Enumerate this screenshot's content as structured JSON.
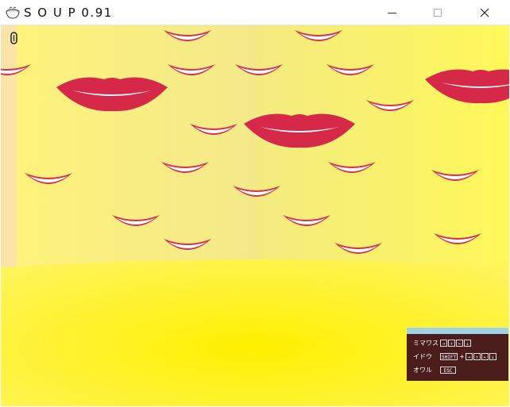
{
  "window": {
    "title": "S O U P 0.91",
    "minimize_icon": "minimize-icon",
    "maximize_icon": "maximize-icon",
    "close_icon": "close-icon"
  },
  "scene": {
    "hud_icon": "paperclip-icon",
    "colors": {
      "wall": "#f4ec6e",
      "floor": "#fff200",
      "lips": "#d8304a",
      "teeth": "#ffffff"
    }
  },
  "help": {
    "rows": [
      {
        "label": "ミマワス",
        "keys": [
          "→",
          "↑",
          "←",
          "↓"
        ],
        "modifier": ""
      },
      {
        "label": "イドウ",
        "keys": [
          "→",
          "↑",
          "←",
          "↓"
        ],
        "modifier": "SHIFT"
      },
      {
        "label": "オワル",
        "keys": [
          "ESC"
        ],
        "modifier": ""
      }
    ],
    "plus": "+"
  }
}
